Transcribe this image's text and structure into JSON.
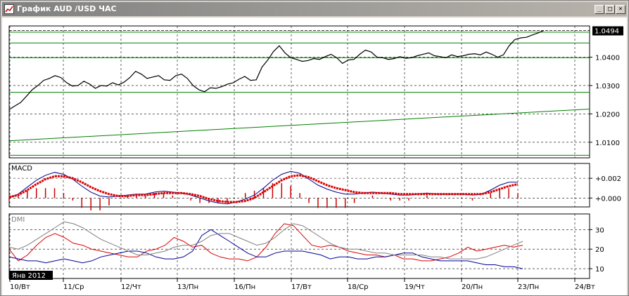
{
  "window": {
    "title": "График AUD /USD  ЧАС",
    "buttons": {
      "minimize": "_",
      "maximize": "□",
      "close": "×"
    }
  },
  "chart_data": [
    {
      "type": "line",
      "panel": "price",
      "title": "",
      "instrument": "AUD/USD",
      "current_price": "1.0494",
      "ylim": [
        1.0045,
        1.051
      ],
      "y_ticks": [
        "1.0400",
        "1.0300",
        "1.0200",
        "1.0100"
      ],
      "y_tick_values": [
        1.04,
        1.03,
        1.02,
        1.01
      ],
      "x": [
        0,
        3,
        6,
        9,
        12,
        15,
        18,
        21,
        24,
        27,
        30,
        33,
        36,
        39,
        42,
        45,
        48,
        51,
        54,
        57,
        60,
        63,
        66,
        69,
        72,
        75,
        78,
        81,
        84,
        87,
        90,
        93,
        96,
        99,
        102,
        105,
        108,
        111,
        114,
        117,
        120,
        123,
        126,
        129,
        132,
        135,
        138,
        141,
        144,
        147,
        150,
        153,
        156,
        159,
        162,
        165,
        168,
        171,
        174,
        177,
        180,
        183,
        186,
        189,
        192,
        195,
        198,
        201,
        204,
        207,
        210,
        213,
        216,
        219,
        222,
        225,
        228,
        231,
        234,
        237,
        240,
        243,
        246,
        249,
        252,
        255,
        258,
        261,
        264,
        267,
        270,
        273,
        276,
        279,
        282,
        285,
        288,
        291,
        294,
        297,
        300,
        303
      ],
      "series": [
        {
          "values": [
            1.0215,
            1.0228,
            1.024,
            1.0262,
            1.0285,
            1.03,
            1.0318,
            1.0325,
            1.0335,
            1.0328,
            1.031,
            1.0298,
            1.03,
            1.0315,
            1.0305,
            1.029,
            1.03,
            1.0298,
            1.031,
            1.0302,
            1.0312,
            1.0328,
            1.035,
            1.034,
            1.0325,
            1.033,
            1.0335,
            1.032,
            1.0318,
            1.0335,
            1.034,
            1.0325,
            1.03,
            1.0285,
            1.0278,
            1.0292,
            1.029,
            1.0296,
            1.0305,
            1.031,
            1.0322,
            1.0332,
            1.0318,
            1.032,
            1.0365,
            1.039,
            1.042,
            1.044,
            1.0415,
            1.0398,
            1.0392,
            1.0385,
            1.0388,
            1.0395,
            1.0392,
            1.0402,
            1.041,
            1.0398,
            1.0378,
            1.039,
            1.0392,
            1.041,
            1.0425,
            1.0418,
            1.04,
            1.0398,
            1.0392,
            1.0395,
            1.0402,
            1.0396,
            1.0398,
            1.0405,
            1.041,
            1.0415,
            1.0405,
            1.0402,
            1.0398,
            1.0408,
            1.0402,
            1.0405,
            1.041,
            1.0412,
            1.0408,
            1.0418,
            1.041,
            1.04,
            1.0408,
            1.044,
            1.0462,
            1.0468,
            1.047,
            1.0478,
            1.0485,
            1.0494,
            1.0494,
            1.0494,
            1.0494,
            1.0494,
            1.0494,
            1.0494,
            1.0494,
            1.0494
          ]
        }
      ],
      "lines": {
        "support_levels": [
          1.0488,
          1.045,
          1.0398,
          1.0276,
          1.0054
        ],
        "trendline": [
          1.0105,
          1.0217
        ]
      }
    },
    {
      "type": "line",
      "panel": "macd",
      "label": "MACD",
      "ylim": [
        -0.0009,
        0.0035
      ],
      "y_ticks": [
        "+0.002",
        "+0.000"
      ],
      "y_tick_values": [
        0.002,
        0.0
      ],
      "series": [
        {
          "values": [
            0.0,
            0.0004,
            0.0011,
            0.0018,
            0.0023,
            0.0026,
            0.0024,
            0.0019,
            0.0012,
            0.0006,
            0.0002,
            0.0001,
            0.0002,
            0.0003,
            0.0004,
            0.0004,
            0.0006,
            0.0007,
            0.0006,
            0.0005,
            0.0003,
            0.0,
            -0.0003,
            -0.0005,
            -0.0006,
            -0.0004,
            -0.0001,
            0.0003,
            0.001,
            0.0018,
            0.0024,
            0.0027,
            0.0025,
            0.0019,
            0.0013,
            0.0009,
            0.0006,
            0.0004,
            0.0004,
            0.0005,
            0.0006,
            0.0005,
            0.0004,
            0.0003,
            0.0003,
            0.0004,
            0.0005,
            0.0004,
            0.0004,
            0.0004,
            0.0004,
            0.0003,
            0.0004,
            0.0008,
            0.0013,
            0.0016,
            0.0016
          ]
        },
        {
          "values": [
            0.0001,
            0.0003,
            0.0008,
            0.0014,
            0.0019,
            0.0022,
            0.0022,
            0.002,
            0.0016,
            0.0011,
            0.0007,
            0.0004,
            0.0002,
            0.0002,
            0.0003,
            0.0003,
            0.0004,
            0.0005,
            0.0005,
            0.0005,
            0.0004,
            0.0002,
            -0.0001,
            -0.0003,
            -0.0004,
            -0.0004,
            -0.0003,
            0.0,
            0.0006,
            0.0012,
            0.0018,
            0.0022,
            0.0023,
            0.0021,
            0.0017,
            0.0013,
            0.001,
            0.0008,
            0.0006,
            0.0005,
            0.0005,
            0.0005,
            0.0005,
            0.0004,
            0.0004,
            0.0004,
            0.0004,
            0.0004,
            0.0004,
            0.0004,
            0.0004,
            0.0004,
            0.0004,
            0.0006,
            0.0009,
            0.0012,
            0.0014
          ]
        }
      ],
      "histogram": [
        -0.0001,
        0.0001,
        0.0003,
        0.0004,
        0.0004,
        0.0004,
        0.0002,
        -0.0001,
        -0.0004,
        -0.0005,
        -0.0005,
        -0.0003,
        0.0,
        0.0001,
        0.0001,
        0.0001,
        0.0002,
        0.0002,
        0.0001,
        0.0,
        -0.0001,
        -0.0002,
        -0.0002,
        -0.0002,
        -0.0002,
        0.0,
        0.0002,
        0.0003,
        0.0004,
        0.0006,
        0.0006,
        0.0005,
        0.0002,
        -0.0002,
        -0.0004,
        -0.0004,
        -0.0004,
        -0.0004,
        -0.0002,
        0.0,
        0.0001,
        0.0,
        -0.0001,
        -0.0001,
        -0.0001,
        0.0,
        0.0001,
        0.0,
        0.0,
        0.0,
        0.0,
        -0.0001,
        0.0,
        0.0002,
        0.0004,
        0.0004,
        0.0002
      ]
    },
    {
      "type": "line",
      "panel": "dmi",
      "label": "DMI",
      "ylim": [
        5,
        38
      ],
      "y_ticks": [
        "30",
        "20",
        "10"
      ],
      "y_tick_values": [
        30,
        20,
        10
      ],
      "series": [
        {
          "values": [
            20,
            14,
            17,
            22,
            26,
            28,
            26,
            23,
            22,
            20,
            19,
            18,
            17,
            16,
            16,
            19,
            20,
            22,
            26,
            24,
            21,
            22,
            18,
            16,
            15,
            15,
            14,
            16,
            21,
            28,
            33,
            32,
            27,
            22,
            21,
            22,
            21,
            19,
            18,
            17,
            17,
            16,
            17,
            15,
            15,
            14,
            14,
            15,
            16,
            18,
            21,
            19,
            20,
            21,
            22,
            21,
            22
          ]
        },
        {
          "values": [
            16,
            15,
            14,
            14,
            13,
            14,
            15,
            14,
            13,
            14,
            16,
            17,
            18,
            19,
            19,
            18,
            16,
            15,
            15,
            16,
            19,
            27,
            30,
            27,
            24,
            21,
            18,
            16,
            16,
            18,
            19,
            19,
            19,
            18,
            17,
            15,
            16,
            16,
            15,
            15,
            16,
            16,
            17,
            18,
            18,
            16,
            15,
            14,
            14,
            14,
            14,
            13,
            12,
            12,
            11,
            11,
            10
          ]
        },
        {
          "values": [
            21,
            20,
            22,
            25,
            28,
            31,
            34,
            33,
            31,
            28,
            25,
            23,
            21,
            19,
            17,
            17,
            18,
            19,
            21,
            22,
            22,
            24,
            27,
            28,
            28,
            26,
            24,
            22,
            23,
            26,
            30,
            33,
            32,
            29,
            26,
            23,
            21,
            20,
            20,
            19,
            18,
            18,
            17,
            17,
            17,
            17,
            16,
            16,
            15,
            15,
            15,
            15,
            16,
            18,
            20,
            22,
            24
          ]
        }
      ],
      "series_colors": [
        "#dd0000",
        "#000099",
        "#808080"
      ]
    }
  ],
  "x_axis": {
    "tick_labels": [
      "10/Вт",
      "11/Ср",
      "12/Чт",
      "13/Пн",
      "16/Пн",
      "17/Вт",
      "18/Ср",
      "19/Чт",
      "20/Пн",
      "23/Пн",
      "24/Вт"
    ],
    "date_box": "Янв 2012"
  },
  "colors": {
    "background": "#ffffff",
    "price_line": "#000000",
    "support_lines": "#008000",
    "macd_signal": "#dd0000",
    "macd_histogram": "#cc0000",
    "frame": "#d4d0c8"
  }
}
